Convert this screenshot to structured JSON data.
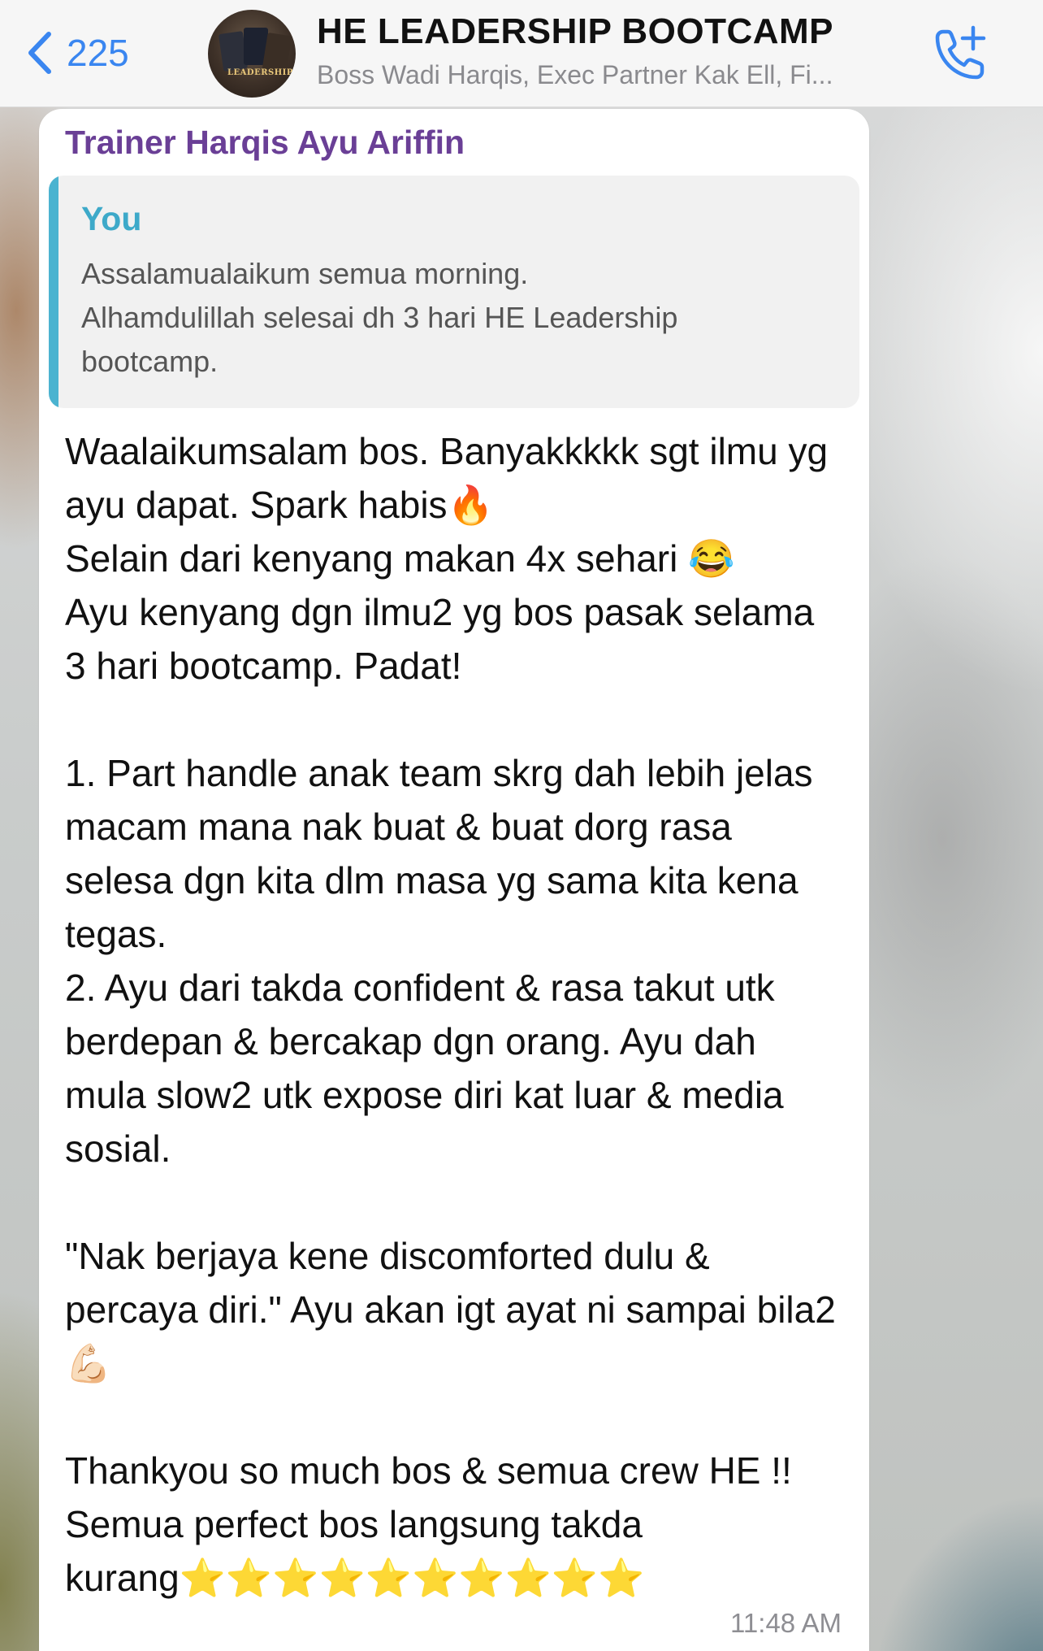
{
  "header": {
    "back_count": "225",
    "title": "HE LEADERSHIP BOOTCAMP",
    "subtitle": "Boss Wadi Harqis, Exec Partner Kak Ell, Fi...",
    "avatar_text": "LEADERSHIP",
    "icons": {
      "back": "chevron-left-icon",
      "call": "add-call-icon"
    },
    "accent_color": "#3a86f0"
  },
  "message": {
    "sender": "Trainer Harqis Ayu Ariffin",
    "sender_color": "#6a3f96",
    "quote": {
      "author": "You",
      "text": "Assalamualaikum semua morning.\nAlhamdulillah selesai dh 3 hari HE Leadership bootcamp."
    },
    "body": "Waalaikumsalam bos. Banyakkkkk sgt ilmu yg ayu dapat. Spark habis🔥\nSelain dari kenyang makan 4x sehari 😂\nAyu kenyang dgn ilmu2 yg bos pasak selama 3 hari bootcamp. Padat!\n\n1. Part handle anak team skrg dah lebih jelas macam mana nak buat & buat dorg rasa selesa dgn kita dlm masa yg sama kita kena tegas.\n2. Ayu dari takda confident & rasa takut utk berdepan & bercakap dgn orang. Ayu dah mula slow2 utk expose diri kat luar & media sosial.\n\n\"Nak berjaya kene discomforted dulu & percaya diri.\" Ayu akan igt ayat ni sampai bila2 💪🏻\n\nThankyou so much bos & semua crew HE !! Semua perfect bos langsung takda kurang⭐⭐⭐⭐⭐⭐⭐⭐⭐⭐",
    "time": "11:48 AM"
  }
}
